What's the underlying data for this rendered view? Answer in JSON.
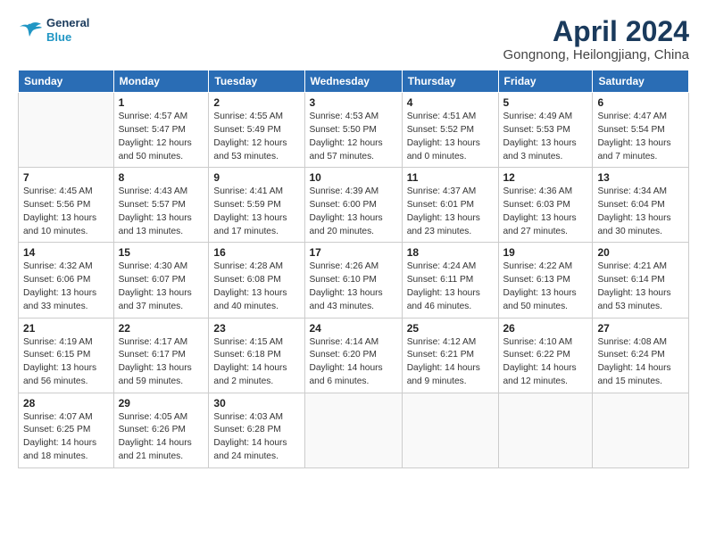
{
  "header": {
    "logo_line1": "General",
    "logo_line2": "Blue",
    "title": "April 2024",
    "subtitle": "Gongnong, Heilongjiang, China"
  },
  "weekdays": [
    "Sunday",
    "Monday",
    "Tuesday",
    "Wednesday",
    "Thursday",
    "Friday",
    "Saturday"
  ],
  "weeks": [
    [
      {
        "day": "",
        "info": ""
      },
      {
        "day": "1",
        "info": "Sunrise: 4:57 AM\nSunset: 5:47 PM\nDaylight: 12 hours\nand 50 minutes."
      },
      {
        "day": "2",
        "info": "Sunrise: 4:55 AM\nSunset: 5:49 PM\nDaylight: 12 hours\nand 53 minutes."
      },
      {
        "day": "3",
        "info": "Sunrise: 4:53 AM\nSunset: 5:50 PM\nDaylight: 12 hours\nand 57 minutes."
      },
      {
        "day": "4",
        "info": "Sunrise: 4:51 AM\nSunset: 5:52 PM\nDaylight: 13 hours\nand 0 minutes."
      },
      {
        "day": "5",
        "info": "Sunrise: 4:49 AM\nSunset: 5:53 PM\nDaylight: 13 hours\nand 3 minutes."
      },
      {
        "day": "6",
        "info": "Sunrise: 4:47 AM\nSunset: 5:54 PM\nDaylight: 13 hours\nand 7 minutes."
      }
    ],
    [
      {
        "day": "7",
        "info": "Sunrise: 4:45 AM\nSunset: 5:56 PM\nDaylight: 13 hours\nand 10 minutes."
      },
      {
        "day": "8",
        "info": "Sunrise: 4:43 AM\nSunset: 5:57 PM\nDaylight: 13 hours\nand 13 minutes."
      },
      {
        "day": "9",
        "info": "Sunrise: 4:41 AM\nSunset: 5:59 PM\nDaylight: 13 hours\nand 17 minutes."
      },
      {
        "day": "10",
        "info": "Sunrise: 4:39 AM\nSunset: 6:00 PM\nDaylight: 13 hours\nand 20 minutes."
      },
      {
        "day": "11",
        "info": "Sunrise: 4:37 AM\nSunset: 6:01 PM\nDaylight: 13 hours\nand 23 minutes."
      },
      {
        "day": "12",
        "info": "Sunrise: 4:36 AM\nSunset: 6:03 PM\nDaylight: 13 hours\nand 27 minutes."
      },
      {
        "day": "13",
        "info": "Sunrise: 4:34 AM\nSunset: 6:04 PM\nDaylight: 13 hours\nand 30 minutes."
      }
    ],
    [
      {
        "day": "14",
        "info": "Sunrise: 4:32 AM\nSunset: 6:06 PM\nDaylight: 13 hours\nand 33 minutes."
      },
      {
        "day": "15",
        "info": "Sunrise: 4:30 AM\nSunset: 6:07 PM\nDaylight: 13 hours\nand 37 minutes."
      },
      {
        "day": "16",
        "info": "Sunrise: 4:28 AM\nSunset: 6:08 PM\nDaylight: 13 hours\nand 40 minutes."
      },
      {
        "day": "17",
        "info": "Sunrise: 4:26 AM\nSunset: 6:10 PM\nDaylight: 13 hours\nand 43 minutes."
      },
      {
        "day": "18",
        "info": "Sunrise: 4:24 AM\nSunset: 6:11 PM\nDaylight: 13 hours\nand 46 minutes."
      },
      {
        "day": "19",
        "info": "Sunrise: 4:22 AM\nSunset: 6:13 PM\nDaylight: 13 hours\nand 50 minutes."
      },
      {
        "day": "20",
        "info": "Sunrise: 4:21 AM\nSunset: 6:14 PM\nDaylight: 13 hours\nand 53 minutes."
      }
    ],
    [
      {
        "day": "21",
        "info": "Sunrise: 4:19 AM\nSunset: 6:15 PM\nDaylight: 13 hours\nand 56 minutes."
      },
      {
        "day": "22",
        "info": "Sunrise: 4:17 AM\nSunset: 6:17 PM\nDaylight: 13 hours\nand 59 minutes."
      },
      {
        "day": "23",
        "info": "Sunrise: 4:15 AM\nSunset: 6:18 PM\nDaylight: 14 hours\nand 2 minutes."
      },
      {
        "day": "24",
        "info": "Sunrise: 4:14 AM\nSunset: 6:20 PM\nDaylight: 14 hours\nand 6 minutes."
      },
      {
        "day": "25",
        "info": "Sunrise: 4:12 AM\nSunset: 6:21 PM\nDaylight: 14 hours\nand 9 minutes."
      },
      {
        "day": "26",
        "info": "Sunrise: 4:10 AM\nSunset: 6:22 PM\nDaylight: 14 hours\nand 12 minutes."
      },
      {
        "day": "27",
        "info": "Sunrise: 4:08 AM\nSunset: 6:24 PM\nDaylight: 14 hours\nand 15 minutes."
      }
    ],
    [
      {
        "day": "28",
        "info": "Sunrise: 4:07 AM\nSunset: 6:25 PM\nDaylight: 14 hours\nand 18 minutes."
      },
      {
        "day": "29",
        "info": "Sunrise: 4:05 AM\nSunset: 6:26 PM\nDaylight: 14 hours\nand 21 minutes."
      },
      {
        "day": "30",
        "info": "Sunrise: 4:03 AM\nSunset: 6:28 PM\nDaylight: 14 hours\nand 24 minutes."
      },
      {
        "day": "",
        "info": ""
      },
      {
        "day": "",
        "info": ""
      },
      {
        "day": "",
        "info": ""
      },
      {
        "day": "",
        "info": ""
      }
    ]
  ]
}
